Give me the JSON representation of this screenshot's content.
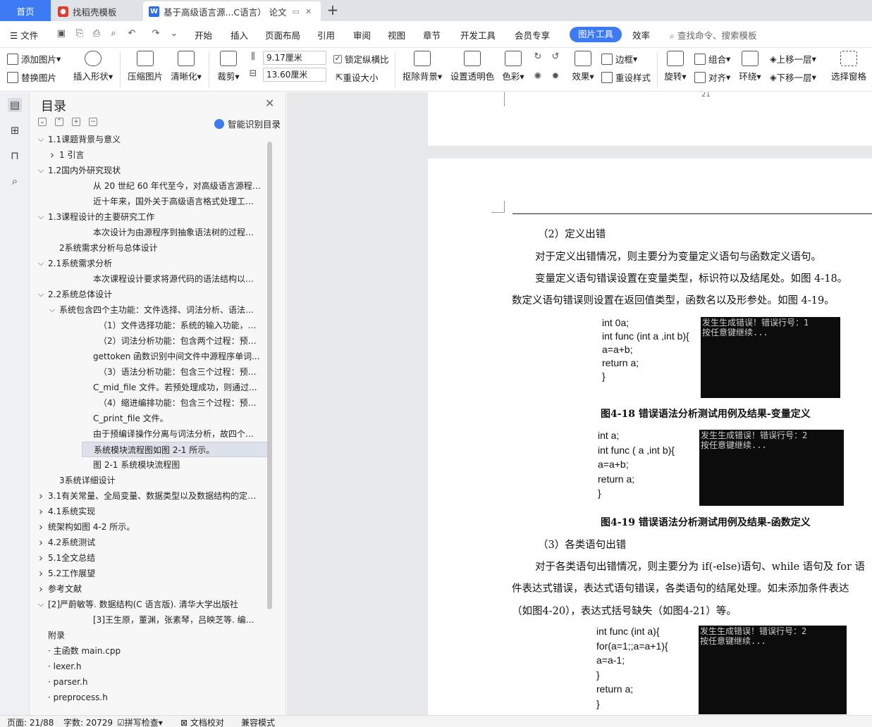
{
  "tabs": {
    "home": "首页",
    "templates": "找稻壳模板",
    "doc": "基于高级语言源...C语言） 论文"
  },
  "menu": {
    "file": "文件",
    "items": [
      "开始",
      "插入",
      "页面布局",
      "引用",
      "审阅",
      "视图",
      "章节",
      "开发工具",
      "会员专享"
    ],
    "picture_tools": "图片工具",
    "efficiency": "效率",
    "search_placeholder": "查找命令、搜索模板"
  },
  "ribbon": {
    "add_picture": "添加图片",
    "replace_picture": "替换图片",
    "insert_shape": "插入形状",
    "compress": "压缩图片",
    "sharpen": "清晰化",
    "crop": "裁剪",
    "width_value": "9.17厘米",
    "height_value": "13.60厘米",
    "lock_ratio": "锁定纵横比",
    "reset_size": "重设大小",
    "remove_bg": "抠除背景",
    "set_transparent": "设置透明色",
    "color": "色彩",
    "effects": "效果",
    "border": "边框",
    "reset_style": "重设样式",
    "rotate": "旋转",
    "group": "组合",
    "align": "对齐",
    "wrap": "环绕",
    "bring_forward": "上移一层",
    "send_backward": "下移一层",
    "selection_pane": "选择窗格"
  },
  "toc": {
    "title": "目录",
    "smart": "智能识别目录",
    "items": [
      {
        "text": "1.1课题背景与意义",
        "arrow": "v"
      },
      {
        "text": "1 引言",
        "arrow": ">"
      },
      {
        "text": "1.2国内外研究现状",
        "arrow": "v"
      },
      {
        "text": "从 20 世纪 60 年代至今，对高级语言源程序格式处理工具的研究...",
        "arrow": ""
      },
      {
        "text": "近十年来，国外关于高级语言格式处理工具的研究与开发...",
        "arrow": ""
      },
      {
        "text": "1.3课程设计的主要研究工作",
        "arrow": "v"
      },
      {
        "text": "本次设计为由源程序到抽象语法树的过程，并将...",
        "arrow": ""
      },
      {
        "text": "2系统需求分析与总体设计",
        "arrow": ""
      },
      {
        "text": "2.1系统需求分析",
        "arrow": "v"
      },
      {
        "text": "本次课程设计要求将源代码的语法结构以树状图表示...",
        "arrow": ""
      },
      {
        "text": "2.2系统总体设计",
        "arrow": "v"
      },
      {
        "text": "系统包含四个主功能：文件选择、词法分析、语法分析...",
        "arrow": "v"
      },
      {
        "text": "（1）文件选择功能：系统的输入功能，选择...",
        "arrow": ""
      },
      {
        "text": "（2）词法分析功能：包含两个过程：预处理...",
        "arrow": ""
      },
      {
        "text": "gettoken 函数识别中间文件中源程序单词...",
        "arrow": ""
      },
      {
        "text": "（3）语法分析功能：包含三个过程：预处理...",
        "arrow": ""
      },
      {
        "text": "C_mid_file 文件。若预处理成功，则通过...",
        "arrow": ""
      },
      {
        "text": "（4）缩进编排功能：包含三个过程：预处理...",
        "arrow": ""
      },
      {
        "text": "C_print_file 文件。",
        "arrow": ""
      },
      {
        "text": "由于预编译操作分离与词法分析，故四个功能...",
        "arrow": ""
      },
      {
        "text": "系统模块流程图如图 2-1 所示。",
        "arrow": ""
      },
      {
        "text": "图 2-1  系统模块流程图",
        "arrow": ""
      },
      {
        "text": "3系统详细设计",
        "arrow": ""
      },
      {
        "text": "3.1有关常量、全局变量、数据类型以及数据结构的定义...",
        "arrow": ">"
      },
      {
        "text": "4.1系统实现",
        "arrow": ">"
      },
      {
        "text": "统架构如图 4-2 所示。",
        "arrow": ">"
      },
      {
        "text": "4.2系统测试",
        "arrow": ">"
      },
      {
        "text": "5.1全文总结",
        "arrow": ">"
      },
      {
        "text": "5.2工作展望",
        "arrow": ">"
      },
      {
        "text": "参考文献",
        "arrow": ">"
      },
      {
        "text": "[2]严蔚敏等. 数据结构(C 语言版). 清华大学出版社",
        "arrow": "v"
      },
      {
        "text": "[3]王生原，董渊，张素琴，吕映芝等. 编译原理...",
        "arrow": ""
      },
      {
        "text": "附录",
        "arrow": ""
      },
      {
        "text": "· 主函数 main.cpp",
        "arrow": ""
      },
      {
        "text": "· lexer.h",
        "arrow": ""
      },
      {
        "text": "· parser.h",
        "arrow": ""
      },
      {
        "text": "· preprocess.h",
        "arrow": ""
      }
    ]
  },
  "doc": {
    "page_number": "21",
    "heading_define": "（2）定义出错",
    "para1": "对于定义出错情况，则主要分为变量定义语句与函数定义语句。",
    "para2a": "变量定义语句错误设置在变量类型，标识符以及结尾处。如图 4-18。",
    "para2b": "数定义语句错误则设置在返回值类型，函数名以及形参处。如图 4-19。",
    "fig18": {
      "code": [
        "int 0a;",
        "int func (int a ,int b){",
        "a=a+b;",
        "return a;",
        "}"
      ],
      "terminal": "发生生成错误！错误行号：1\n按任意键继续...",
      "caption": "图4-18  错误语法分析测试用例及结果-变量定义"
    },
    "fig19": {
      "code": [
        "int a;",
        "int func ( a ,int b){",
        "a=a+b;",
        "return a;",
        "}"
      ],
      "terminal": "发生生成错误！错误行号：2\n按任意键继续...",
      "caption": "图4-19  错误语法分析测试用例及结果-函数定义"
    },
    "heading_stmt": "（3）各类语句出错",
    "para3a": "对于各类语句出错情况，则主要分为 if(-else)语句、while 语句及 for 语",
    "para3b": "件表达式错误，表达式语句错误，各类语句的结尾处理。如未添加条件表达",
    "para3c": "（如图4-20），表达式括号缺失（如图4-21）等。",
    "fig20": {
      "code": [
        "int func (int a){",
        "for(a=1;;a=a+1){",
        "a=a-1;",
        "}",
        "return a;",
        "}"
      ],
      "terminal": "发生生成错误！错误行号：2\n按任意键继续..."
    }
  },
  "status": {
    "page": "页面: 21/88",
    "words": "字数: 20729",
    "spell": "拼写检查",
    "proof": "文档校对",
    "compat": "兼容模式"
  }
}
